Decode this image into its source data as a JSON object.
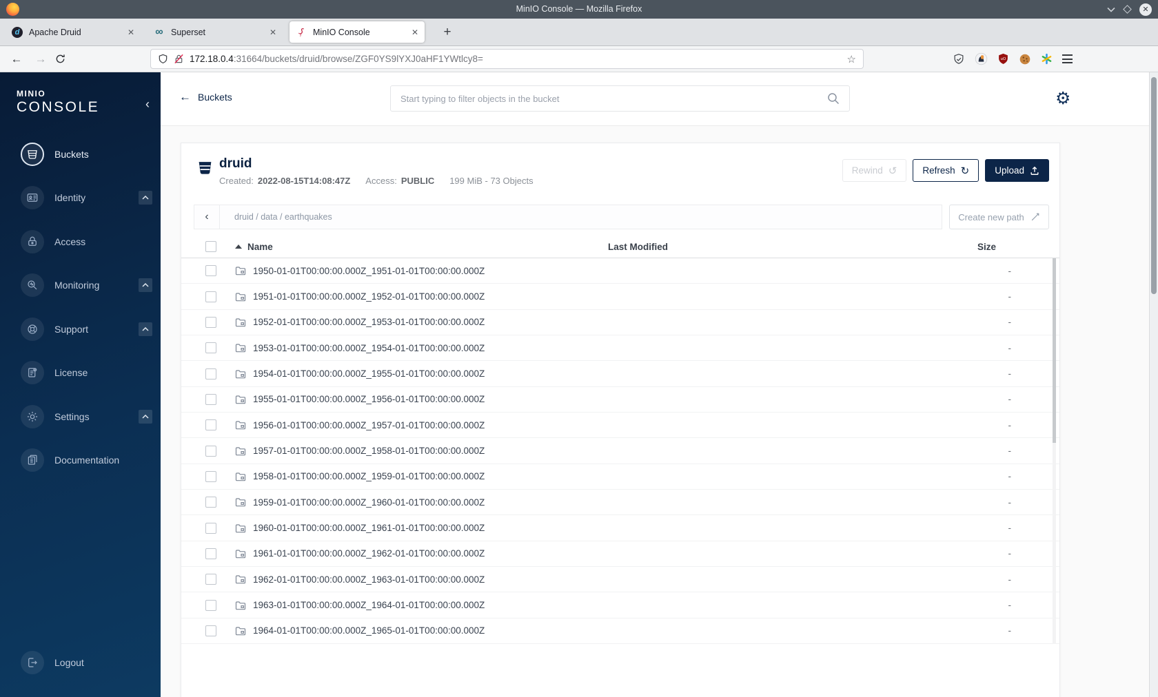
{
  "window": {
    "title": "MinIO Console — Mozilla Firefox"
  },
  "browser": {
    "tabs": [
      {
        "label": "Apache Druid"
      },
      {
        "label": "Superset"
      },
      {
        "label": "MinIO Console",
        "active": true
      }
    ],
    "url_domain": "172.18.0.4",
    "url_rest": ":31664/buckets/druid/browse/ZGF0YS9lYXJ0aHF1YWtlcy8="
  },
  "icons": {
    "close": "✕",
    "plus": "+",
    "back_arrow": "←",
    "forward_arrow": "→",
    "chevron_left": "‹",
    "star": "☆",
    "gear": "⚙",
    "rewind": "↺",
    "refresh": "↻",
    "infinity": "∞",
    "druid_glyph": "d"
  },
  "sidebar": {
    "logo_line1": "MINIO",
    "logo_line2": "CONSOLE",
    "items": [
      {
        "label": "Buckets",
        "active": true
      },
      {
        "label": "Identity",
        "expandable": true
      },
      {
        "label": "Access"
      },
      {
        "label": "Monitoring",
        "expandable": true
      },
      {
        "label": "Support",
        "expandable": true
      },
      {
        "label": "License"
      },
      {
        "label": "Settings",
        "expandable": true
      },
      {
        "label": "Documentation"
      }
    ],
    "logout_label": "Logout"
  },
  "header": {
    "back_label": "Buckets",
    "search_placeholder": "Start typing to filter objects in the bucket"
  },
  "bucket": {
    "name": "druid",
    "created_label": "Created:",
    "created_value": "2022-08-15T14:08:47Z",
    "access_label": "Access:",
    "access_value": "PUBLIC",
    "summary": "199 MiB - 73 Objects",
    "rewind_label": "Rewind",
    "refresh_label": "Refresh",
    "upload_label": "Upload"
  },
  "browse": {
    "breadcrumb": "druid / data / earthquakes",
    "create_path_label": "Create new path",
    "columns": {
      "name": "Name",
      "last_modified": "Last Modified",
      "size": "Size"
    },
    "rows": [
      {
        "name": "1950-01-01T00:00:00.000Z_1951-01-01T00:00:00.000Z",
        "size": "-"
      },
      {
        "name": "1951-01-01T00:00:00.000Z_1952-01-01T00:00:00.000Z",
        "size": "-"
      },
      {
        "name": "1952-01-01T00:00:00.000Z_1953-01-01T00:00:00.000Z",
        "size": "-"
      },
      {
        "name": "1953-01-01T00:00:00.000Z_1954-01-01T00:00:00.000Z",
        "size": "-"
      },
      {
        "name": "1954-01-01T00:00:00.000Z_1955-01-01T00:00:00.000Z",
        "size": "-"
      },
      {
        "name": "1955-01-01T00:00:00.000Z_1956-01-01T00:00:00.000Z",
        "size": "-"
      },
      {
        "name": "1956-01-01T00:00:00.000Z_1957-01-01T00:00:00.000Z",
        "size": "-"
      },
      {
        "name": "1957-01-01T00:00:00.000Z_1958-01-01T00:00:00.000Z",
        "size": "-"
      },
      {
        "name": "1958-01-01T00:00:00.000Z_1959-01-01T00:00:00.000Z",
        "size": "-"
      },
      {
        "name": "1959-01-01T00:00:00.000Z_1960-01-01T00:00:00.000Z",
        "size": "-"
      },
      {
        "name": "1960-01-01T00:00:00.000Z_1961-01-01T00:00:00.000Z",
        "size": "-"
      },
      {
        "name": "1961-01-01T00:00:00.000Z_1962-01-01T00:00:00.000Z",
        "size": "-"
      },
      {
        "name": "1962-01-01T00:00:00.000Z_1963-01-01T00:00:00.000Z",
        "size": "-"
      },
      {
        "name": "1963-01-01T00:00:00.000Z_1964-01-01T00:00:00.000Z",
        "size": "-"
      },
      {
        "name": "1964-01-01T00:00:00.000Z_1965-01-01T00:00:00.000Z",
        "size": "-"
      }
    ]
  },
  "colors": {
    "navy": "#0c2548",
    "minio_red": "#c72c48"
  }
}
